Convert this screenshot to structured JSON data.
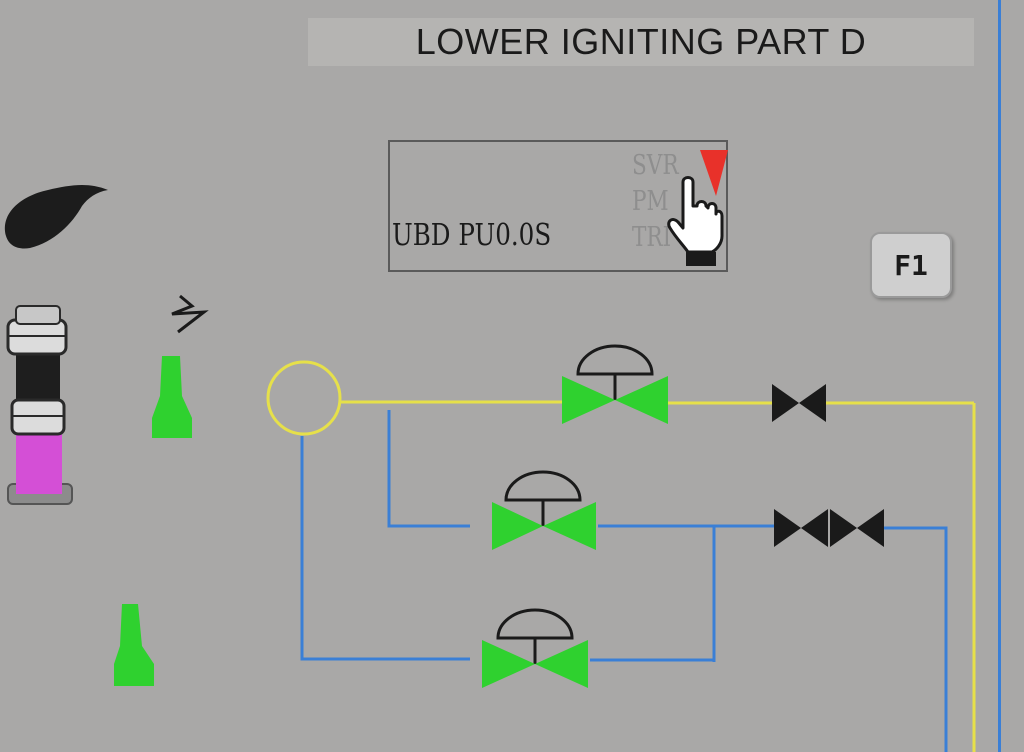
{
  "title": "LOWER IGNITING PART D",
  "status_panel": {
    "code": "UBD PU0.0S",
    "labels": [
      "SVR",
      "PM",
      "TRI"
    ],
    "indicator_color": "#e8312a"
  },
  "buttons": {
    "f1_label": "F1"
  },
  "icons": {
    "flame": "flame-icon",
    "lightning": "lightning-icon",
    "igniter": "igniter-icon",
    "burner": "burner-icon",
    "hand_cursor": "hand-cursor-icon"
  },
  "colors": {
    "background": "#a9a8a7",
    "valve_open": "#2fd12f",
    "valve_closed": "#1a1a1a",
    "line_yellow": "#e6e04a",
    "line_blue": "#3a7fd6",
    "flame_indicator": "#d44fd6"
  },
  "valves": [
    {
      "name": "control-valve-upper",
      "state": "open"
    },
    {
      "name": "control-valve-middle",
      "state": "open"
    },
    {
      "name": "control-valve-lower",
      "state": "open"
    },
    {
      "name": "shutoff-valve-upper",
      "state": "closed"
    },
    {
      "name": "shutoff-valve-middle-a",
      "state": "closed"
    },
    {
      "name": "shutoff-valve-middle-b",
      "state": "closed"
    }
  ]
}
